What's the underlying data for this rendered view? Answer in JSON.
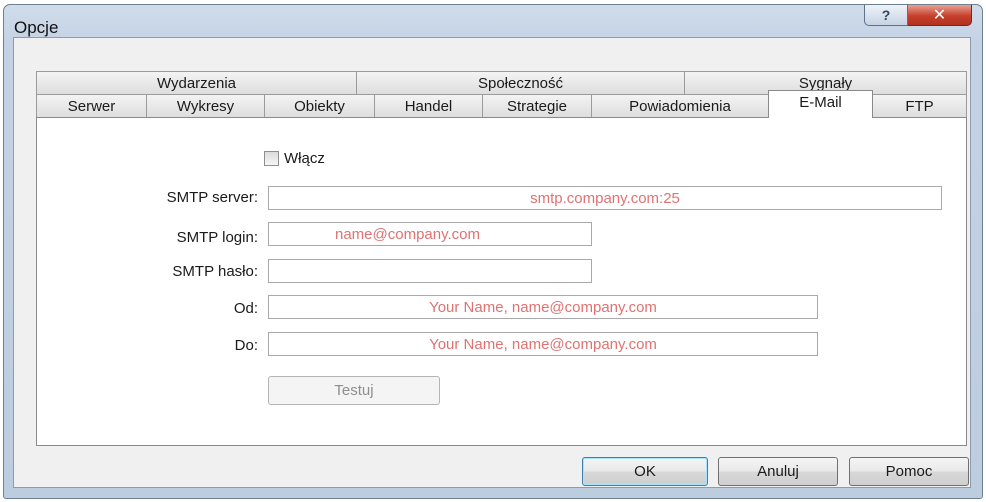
{
  "window": {
    "title": "Opcje",
    "help_glyph": "?",
    "close_glyph": "✕"
  },
  "tabs": {
    "row_top": [
      "Wydarzenia",
      "Społeczność",
      "Sygnały"
    ],
    "row_bottom": [
      "Serwer",
      "Wykresy",
      "Obiekty",
      "Handel",
      "Strategie",
      "Powiadomienia",
      "E-Mail",
      "FTP"
    ],
    "active": "E-Mail"
  },
  "email": {
    "enable_label": "Włącz",
    "enable_checked": false,
    "smtp_server_label": "SMTP server:",
    "smtp_server_placeholder": "smtp.company.com:25",
    "smtp_login_label": "SMTP login:",
    "smtp_login_placeholder": "name@company.com",
    "smtp_password_label": "SMTP hasło:",
    "smtp_password_value": "",
    "from_label": "Od:",
    "from_placeholder": "Your Name, name@company.com",
    "to_label": "Do:",
    "to_placeholder": "Your Name, name@company.com",
    "test_button": "Testuj"
  },
  "buttons": {
    "ok": "OK",
    "cancel": "Anuluj",
    "help": "Pomoc"
  },
  "colors": {
    "placeholder_text": "#e07272",
    "close_button": "#c6402c",
    "titlebar": "#c3d2e4"
  },
  "icons": {
    "help": "help-icon",
    "close": "close-icon"
  }
}
